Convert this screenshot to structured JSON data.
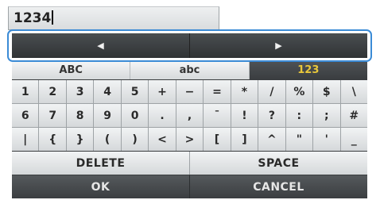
{
  "input": {
    "value": "1234"
  },
  "navigation": {
    "left_icon": "left-arrow-icon",
    "right_icon": "right-arrow-icon",
    "left_glyph": "◀",
    "right_glyph": "▶"
  },
  "modes": [
    {
      "label": "ABC",
      "active": false
    },
    {
      "label": "abc",
      "active": false
    },
    {
      "label": "123",
      "active": true
    }
  ],
  "colors": {
    "active_mode_text": "#e8c73a",
    "focus_outline": "#3b8bd6",
    "dark_key": "#3b3e41",
    "light_key": "#d5d8da"
  },
  "rows": [
    [
      "1",
      "2",
      "3",
      "4",
      "5",
      "+",
      "−",
      "=",
      "*",
      "/",
      "%",
      "$",
      "\\"
    ],
    [
      "6",
      "7",
      "8",
      "9",
      "0",
      ".",
      ",",
      "¯",
      "!",
      "?",
      ":",
      ";",
      "#"
    ],
    [
      "|",
      "{",
      "}",
      "(",
      ")",
      "<",
      ">",
      "[",
      "]",
      "^",
      "\"",
      "'",
      "_"
    ]
  ],
  "actions": {
    "delete": "DELETE",
    "space": "SPACE",
    "ok": "OK",
    "cancel": "CANCEL"
  }
}
